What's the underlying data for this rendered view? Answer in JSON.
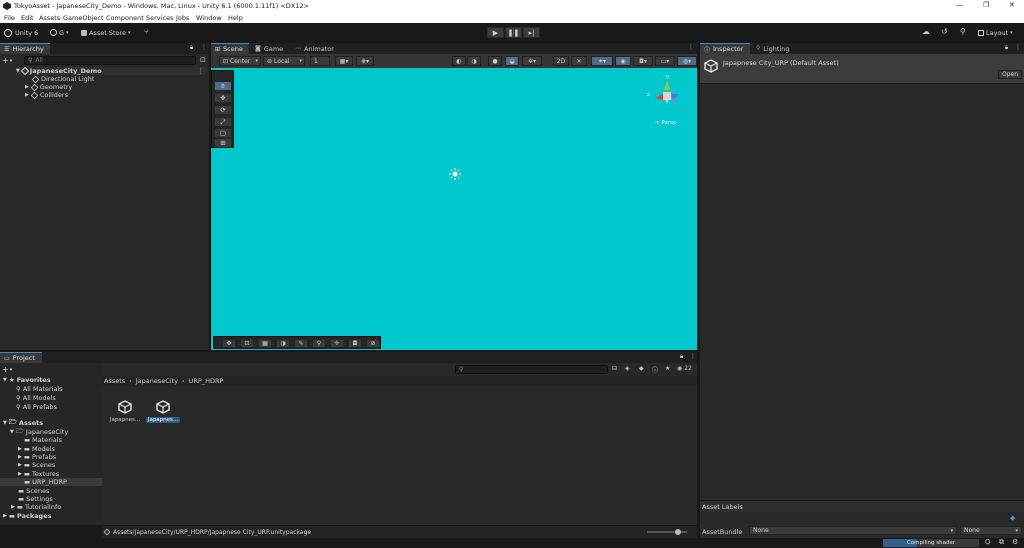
{
  "window": {
    "title": "TokyoAsset - JapaneseCity_Demo - Windows, Mac, Linux - Unity 6.1 (6000.1.11f1) <DX12>",
    "controls": {
      "minimize": "—",
      "restore": "❐",
      "close": "✕"
    }
  },
  "menu": [
    "File",
    "Edit",
    "Assets",
    "GameObject",
    "Component",
    "Services",
    "Jobs",
    "Window",
    "Help"
  ],
  "toolbar": {
    "unity_label": "Unity 6",
    "account_label": "G",
    "asset_store_label": "Asset Store",
    "layout_label": "Layout"
  },
  "hierarchy": {
    "tab_label": "Hierarchy",
    "search_placeholder": "All",
    "scene_name": "JapaneseCity_Demo",
    "items": [
      "Directional Light",
      "Geometry",
      "Colliders"
    ]
  },
  "scene_view": {
    "tabs": [
      "Scene",
      "Game",
      "Animator"
    ],
    "pivot_label": "Center",
    "space_label": "Local",
    "grid_value": "1",
    "gizmo_axis_y": "y",
    "gizmo_axis_x": "x",
    "persp_label": "Persp",
    "background_color": "#00c8cc"
  },
  "inspector": {
    "tabs": [
      "Inspector",
      "Lighting"
    ],
    "asset_title": "Japapnese City_URP (Default Asset)",
    "open_label": "Open",
    "asset_labels_heading": "Asset Labels",
    "asset_bundle_label": "AssetBundle",
    "asset_bundle_value": "None",
    "asset_variant_value": "None"
  },
  "project": {
    "tab_label": "Project",
    "favorites_label": "Favorites",
    "favorites": [
      "All Materials",
      "All Models",
      "All Prefabs"
    ],
    "assets_label": "Assets",
    "japanese_city": "JapaneseCity",
    "japanese_city_children": [
      "Materials",
      "Models",
      "Prefabs",
      "Scenes",
      "Textures",
      "URP_HDRP"
    ],
    "assets_children": [
      "Scenes",
      "Settings",
      "TutorialInfo"
    ],
    "packages_label": "Packages",
    "breadcrumb": [
      "Assets",
      "JapaneseCity",
      "URP_HDRP"
    ],
    "count": "22",
    "tiles": [
      {
        "name": "Japapnes...",
        "selected": false
      },
      {
        "name": "Japapnes...",
        "selected": true
      }
    ],
    "footer_path": "Assets/JapaneseCity/URP_HDRP/Japapnese City_URP.unitypackage"
  },
  "status": {
    "progress_label": "Compiling shader",
    "progress": 0.35
  }
}
